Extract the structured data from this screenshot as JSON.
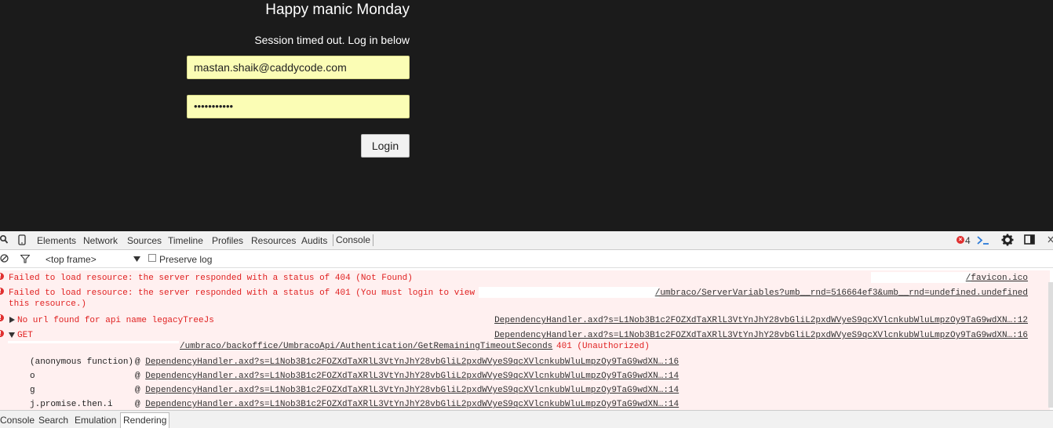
{
  "login": {
    "greeting": "Happy manic Monday",
    "session_message": "Session timed out. Log in below",
    "email_value": "mastan.shaik@caddycode.com",
    "password_value": "•••••••••••",
    "login_label": "Login"
  },
  "devtools": {
    "tabs": [
      "Elements",
      "Network",
      "Sources",
      "Timeline",
      "Profiles",
      "Resources",
      "Audits",
      "Console"
    ],
    "error_count": "4",
    "frame_select": "<top frame>",
    "preserve_log_label": "Preserve log",
    "messages": [
      {
        "text": "Failed to load resource: the server responded with a status of 404 (Not Found)",
        "source": "/favicon.ico"
      },
      {
        "text_line1": "Failed to load resource: the server responded with a status of 401 (You must login to view",
        "text_line2": "this resource.)",
        "source": "/umbraco/ServerVariables?umb__rnd=516664ef3&umb__rnd=undefined.undefined"
      },
      {
        "text": "No url found for api name legacyTreeJs",
        "source": "DependencyHandler.axd?s=L1Nob3B1c2FOZXdTaXRlL3VtYnJhY28vbGliL2pxdWVyeS9qcXVlcnkubWluLmpzOy9TaG9wdXN…:12"
      },
      {
        "text": "GET",
        "url": "/umbraco/backoffice/UmbracoApi/Authentication/GetRemainingTimeoutSeconds",
        "status": "401 (Unauthorized)",
        "source": "DependencyHandler.axd?s=L1Nob3B1c2FOZXdTaXRlL3VtYnJhY28vbGliL2pxdWVyeS9qcXVlcnkubWluLmpzOy9TaG9wdXN…:16"
      }
    ],
    "stack": [
      {
        "fn": "(anonymous function)",
        "at": "@",
        "link": "DependencyHandler.axd?s=L1Nob3B1c2FOZXdTaXRlL3VtYnJhY28vbGliL2pxdWVyeS9qcXVlcnkubWluLmpzOy9TaG9wdXN…:16"
      },
      {
        "fn": "o",
        "at": "@",
        "link": "DependencyHandler.axd?s=L1Nob3B1c2FOZXdTaXRlL3VtYnJhY28vbGliL2pxdWVyeS9qcXVlcnkubWluLmpzOy9TaG9wdXN…:14"
      },
      {
        "fn": "g",
        "at": "@",
        "link": "DependencyHandler.axd?s=L1Nob3B1c2FOZXdTaXRlL3VtYnJhY28vbGliL2pxdWVyeS9qcXVlcnkubWluLmpzOy9TaG9wdXN…:14"
      },
      {
        "fn": "j.promise.then.i",
        "at": "@",
        "link": "DependencyHandler.axd?s=L1Nob3B1c2FOZXdTaXRlL3VtYnJhY28vbGliL2pxdWVyeS9qcXVlcnkubWluLmpzOy9TaG9wdXN…:14"
      }
    ],
    "drawer_tabs": [
      "Console",
      "Search",
      "Emulation",
      "Rendering"
    ]
  },
  "colors": {
    "page_bg": "#1b1b1b",
    "input_bg": "#fbfdb5",
    "error_red": "#e02020",
    "error_bg": "#fff0f0",
    "accent_blue": "#2a7ad8"
  }
}
